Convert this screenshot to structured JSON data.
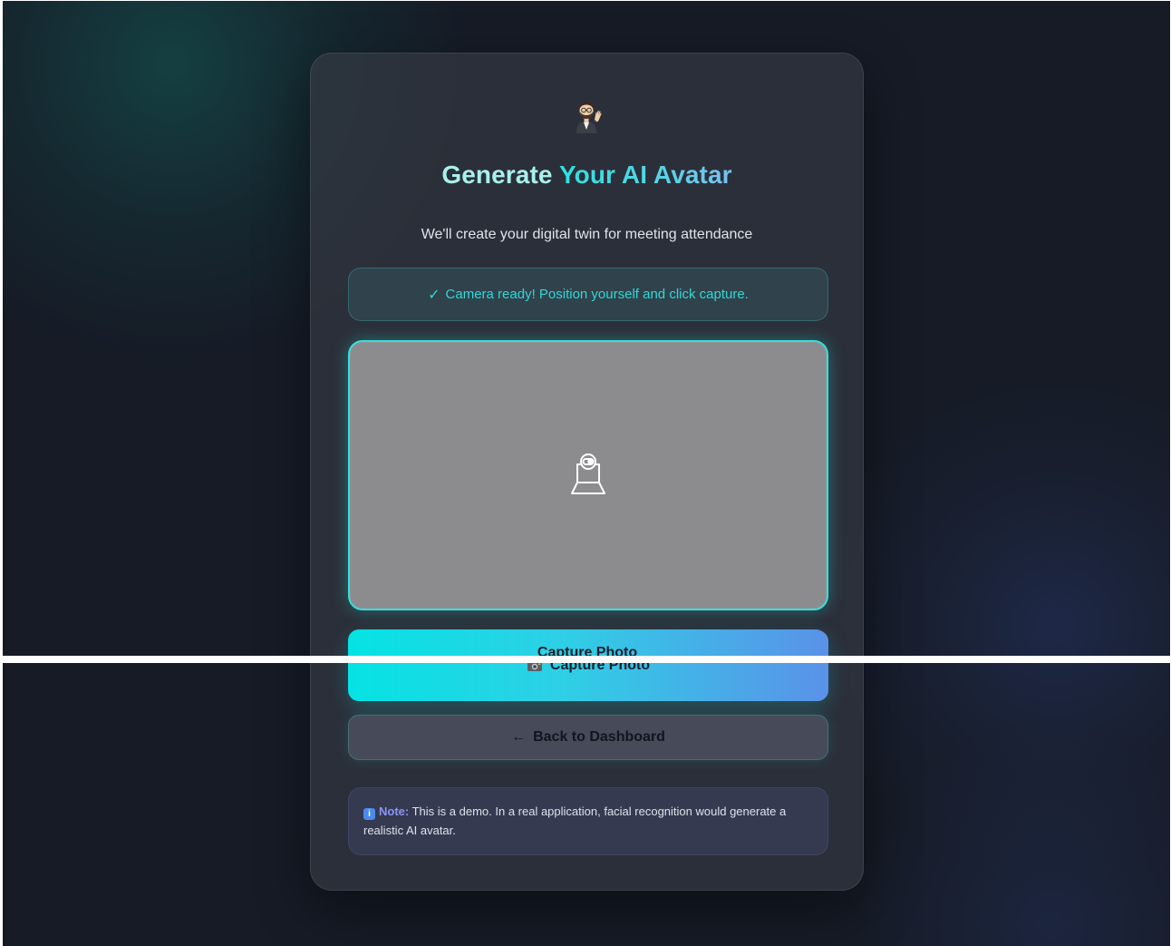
{
  "page": {
    "hero_icon": "person-waving-emoji",
    "title_part1": "Generate",
    "title_part2": "Your AI Avatar",
    "subtitle": "We'll create your digital twin for meeting attendance"
  },
  "status": {
    "check_symbol": "✓",
    "message": "Camera ready! Position yourself and click capture."
  },
  "camera": {
    "icon": "webcam-icon"
  },
  "buttons": {
    "capture_label": "Capture Photo",
    "capture_icon": "camera-icon",
    "back_arrow": "←",
    "back_label": "Back to Dashboard"
  },
  "note": {
    "icon_glyph": "i",
    "label": "Note:",
    "text": "This is a demo. In a real application, facial recognition would generate a realistic AI avatar."
  },
  "colors": {
    "accent": "#30d8d6",
    "capture_gradient_start": "#05e3e3",
    "capture_gradient_end": "#5a92e8",
    "note_label": "#8e95f4",
    "background": "#161b26"
  }
}
